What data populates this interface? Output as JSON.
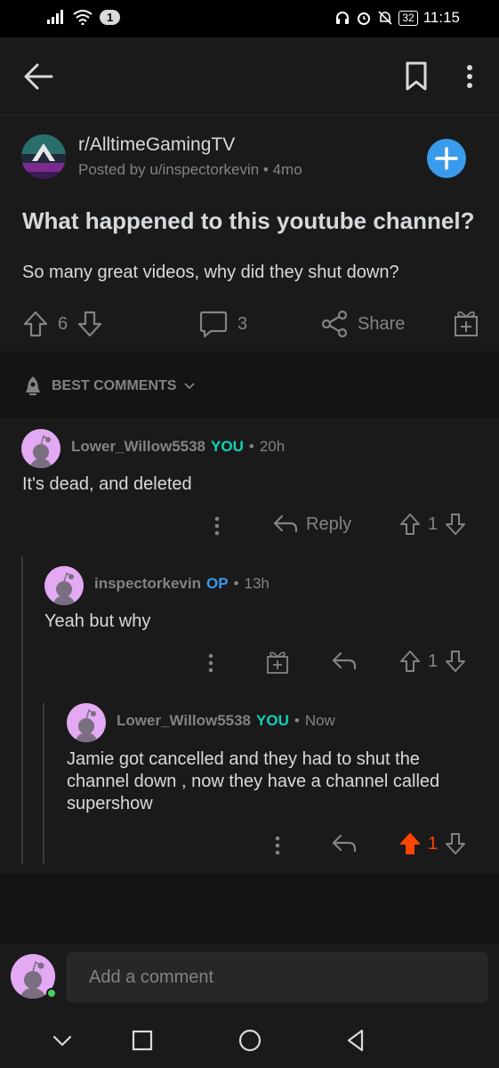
{
  "status_bar": {
    "sim_badge": "1",
    "battery": "32",
    "time": "11:15"
  },
  "post": {
    "subreddit": "r/AlltimeGamingTV",
    "posted_by": "Posted by u/inspectorkevin",
    "age": "4mo",
    "title": "What happened to this youtube channel?",
    "body": "So many great videos, why did they shut down?",
    "score": "6",
    "comment_count": "3",
    "share_label": "Share"
  },
  "sort": {
    "label": "BEST COMMENTS"
  },
  "comments": [
    {
      "user": "Lower_Willow5538",
      "flair": "YOU",
      "time": "20h",
      "text": "It's dead, and deleted",
      "reply_label": "Reply",
      "score": "1",
      "upvoted": false
    },
    {
      "user": "inspectorkevin",
      "flair": "OP",
      "time": "13h",
      "text": "Yeah but why",
      "score": "1",
      "upvoted": false
    },
    {
      "user": "Lower_Willow5538",
      "flair": "YOU",
      "time": "Now",
      "text": "Jamie got cancelled and they had to shut the channel down , now they have a channel called supershow",
      "score": "1",
      "upvoted": true
    }
  ],
  "composer": {
    "placeholder": "Add a comment"
  },
  "colors": {
    "background": "#1a1a1b",
    "text": "#d7dadc",
    "muted": "#818384",
    "you_flair": "#0dd3bb",
    "op_flair": "#3a9bec",
    "upvote": "#ff4500",
    "join_button": "#3a9bec"
  },
  "icons": [
    "signal-icon",
    "wifi-icon",
    "headphones-icon",
    "alarm-icon",
    "mute-icon",
    "battery-icon",
    "back-arrow-icon",
    "bookmark-icon",
    "more-vertical-icon",
    "plus-icon",
    "upvote-icon",
    "downvote-icon",
    "comment-icon",
    "share-icon",
    "gift-icon",
    "rocket-icon",
    "chevron-down-icon",
    "reply-icon",
    "snoo-avatar-icon"
  ]
}
